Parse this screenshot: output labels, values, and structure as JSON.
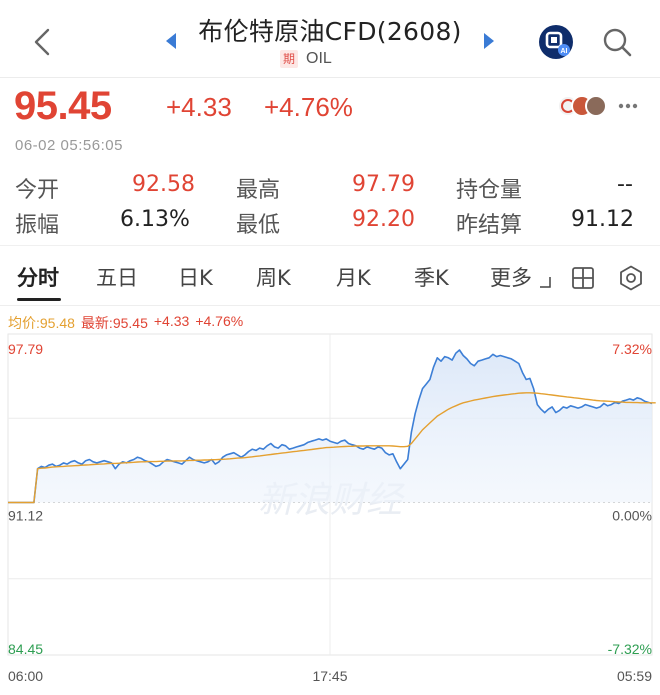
{
  "header": {
    "title": "布伦特原油CFD(2608)",
    "qi_badge": "期",
    "subtitle": "OIL",
    "icons": {
      "back": "chevron-left-icon",
      "prev": "triangle-left-icon",
      "next": "triangle-right-icon",
      "ai": "ai-assistant-icon",
      "search": "search-icon"
    }
  },
  "quote": {
    "price": "95.45",
    "change": "+4.33",
    "change_pct": "+4.76%",
    "timestamp": "06-02 05:56:05",
    "colors": {
      "up": "#e04434",
      "avg_line": "#e4a030",
      "price_line": "#3d7fd6"
    }
  },
  "stats": {
    "open_label": "今开",
    "open_value": "92.58",
    "high_label": "最高",
    "high_value": "97.79",
    "oi_label": "持仓量",
    "oi_value": "--",
    "amp_label": "振幅",
    "amp_value": "6.13%",
    "low_label": "最低",
    "low_value": "92.20",
    "settle_label": "昨结算",
    "settle_value": "91.12"
  },
  "tabs": [
    {
      "label": "分时",
      "active": true
    },
    {
      "label": "五日"
    },
    {
      "label": "日K"
    },
    {
      "label": "周K"
    },
    {
      "label": "月K"
    },
    {
      "label": "季K"
    },
    {
      "label": "更多"
    }
  ],
  "legend": {
    "avg": "均价:95.48",
    "latest": "最新:95.45",
    "change": "+4.33",
    "pct": "+4.76%"
  },
  "chart_data": {
    "type": "line",
    "title": "",
    "y_left_ticks": [
      "97.79",
      "91.12",
      "84.45"
    ],
    "y_right_ticks": [
      "7.32%",
      "0.00%",
      "-7.32%"
    ],
    "x_ticks": [
      "06:00",
      "17:45",
      "05:59"
    ],
    "ylim": [
      84.45,
      97.79
    ],
    "prev_settle": 91.12,
    "watermark": "新浪财经",
    "series": [
      {
        "name": "最新",
        "values": [
          91.12,
          91.12,
          91.12,
          91.12,
          91.12,
          91.12,
          91.12,
          91.12,
          92.6,
          92.7,
          92.65,
          92.75,
          92.8,
          92.7,
          92.75,
          92.85,
          92.8,
          92.9,
          92.95,
          92.85,
          92.8,
          92.95,
          93.0,
          92.9,
          92.85,
          92.9,
          92.95,
          92.9,
          92.85,
          92.6,
          92.8,
          92.9,
          92.85,
          92.95,
          93.0,
          93.1,
          93.05,
          92.95,
          92.9,
          92.8,
          92.7,
          92.75,
          92.9,
          93.0,
          92.95,
          92.9,
          92.85,
          92.8,
          92.95,
          93.1,
          93.0,
          92.95,
          92.9,
          92.85,
          92.9,
          93.0,
          92.8,
          92.9,
          93.1,
          93.2,
          93.25,
          93.3,
          93.2,
          93.1,
          93.2,
          93.35,
          93.45,
          93.4,
          93.5,
          93.45,
          93.6,
          93.7,
          93.55,
          93.5,
          93.65,
          93.6,
          93.45,
          93.5,
          93.55,
          93.6,
          93.65,
          93.75,
          93.8,
          93.85,
          93.9,
          93.85,
          93.9,
          93.8,
          93.75,
          93.7,
          93.8,
          93.85,
          93.7,
          93.65,
          93.6,
          93.5,
          93.45,
          93.55,
          93.5,
          93.45,
          93.55,
          93.5,
          93.3,
          93.2,
          93.25,
          92.9,
          92.6,
          92.8,
          93.0,
          94.2,
          95.0,
          95.6,
          96.1,
          96.3,
          96.5,
          97.05,
          97.45,
          97.3,
          97.5,
          97.45,
          97.35,
          97.65,
          97.79,
          97.55,
          97.4,
          97.2,
          97.1,
          97.3,
          97.35,
          97.4,
          97.45,
          97.6,
          97.5,
          97.55,
          97.5,
          97.45,
          97.4,
          97.3,
          97.2,
          96.8,
          96.5,
          96.55,
          96.1,
          95.4,
          95.2,
          95.05,
          95.2,
          95.3,
          95.05,
          95.15,
          95.3,
          95.25,
          95.35,
          95.3,
          95.25,
          95.3,
          95.4,
          95.35,
          95.3,
          95.25,
          95.3,
          95.45,
          95.35,
          95.4,
          95.5,
          95.45,
          95.55,
          95.6,
          95.65,
          95.6,
          95.7,
          95.65,
          95.55,
          95.5,
          95.45
        ]
      },
      {
        "name": "均价",
        "values": [
          91.12,
          91.12,
          91.12,
          91.12,
          91.12,
          91.12,
          91.12,
          91.12,
          92.6,
          92.62,
          92.63,
          92.65,
          92.67,
          92.68,
          92.69,
          92.7,
          92.71,
          92.72,
          92.73,
          92.74,
          92.75,
          92.76,
          92.77,
          92.78,
          92.79,
          92.8,
          92.81,
          92.82,
          92.83,
          92.83,
          92.84,
          92.85,
          92.86,
          92.87,
          92.88,
          92.89,
          92.9,
          92.9,
          92.91,
          92.91,
          92.91,
          92.92,
          92.92,
          92.93,
          92.93,
          92.94,
          92.94,
          92.94,
          92.95,
          92.96,
          92.96,
          92.97,
          92.97,
          92.98,
          92.98,
          92.99,
          92.99,
          93.0,
          93.01,
          93.02,
          93.03,
          93.05,
          93.06,
          93.07,
          93.08,
          93.1,
          93.12,
          93.14,
          93.16,
          93.18,
          93.2,
          93.22,
          93.24,
          93.26,
          93.28,
          93.3,
          93.32,
          93.34,
          93.36,
          93.38,
          93.4,
          93.42,
          93.44,
          93.46,
          93.48,
          93.5,
          93.52,
          93.53,
          93.54,
          93.55,
          93.56,
          93.57,
          93.58,
          93.58,
          93.59,
          93.59,
          93.59,
          93.6,
          93.6,
          93.6,
          93.6,
          93.6,
          93.6,
          93.6,
          93.59,
          93.58,
          93.56,
          93.56,
          93.58,
          93.7,
          93.9,
          94.1,
          94.3,
          94.45,
          94.6,
          94.75,
          94.9,
          95.0,
          95.1,
          95.2,
          95.28,
          95.35,
          95.42,
          95.48,
          95.52,
          95.56,
          95.6,
          95.63,
          95.66,
          95.69,
          95.72,
          95.75,
          95.78,
          95.8,
          95.82,
          95.84,
          95.86,
          95.88,
          95.9,
          95.91,
          95.92,
          95.92,
          95.91,
          95.9,
          95.88,
          95.86,
          95.84,
          95.82,
          95.8,
          95.78,
          95.76,
          95.74,
          95.72,
          95.7,
          95.68,
          95.66,
          95.64,
          95.62,
          95.6,
          95.58,
          95.57,
          95.56,
          95.55,
          95.54,
          95.53,
          95.52,
          95.51,
          95.5,
          95.5,
          95.49,
          95.49,
          95.48,
          95.48,
          95.48,
          95.48,
          95.48
        ]
      }
    ]
  }
}
